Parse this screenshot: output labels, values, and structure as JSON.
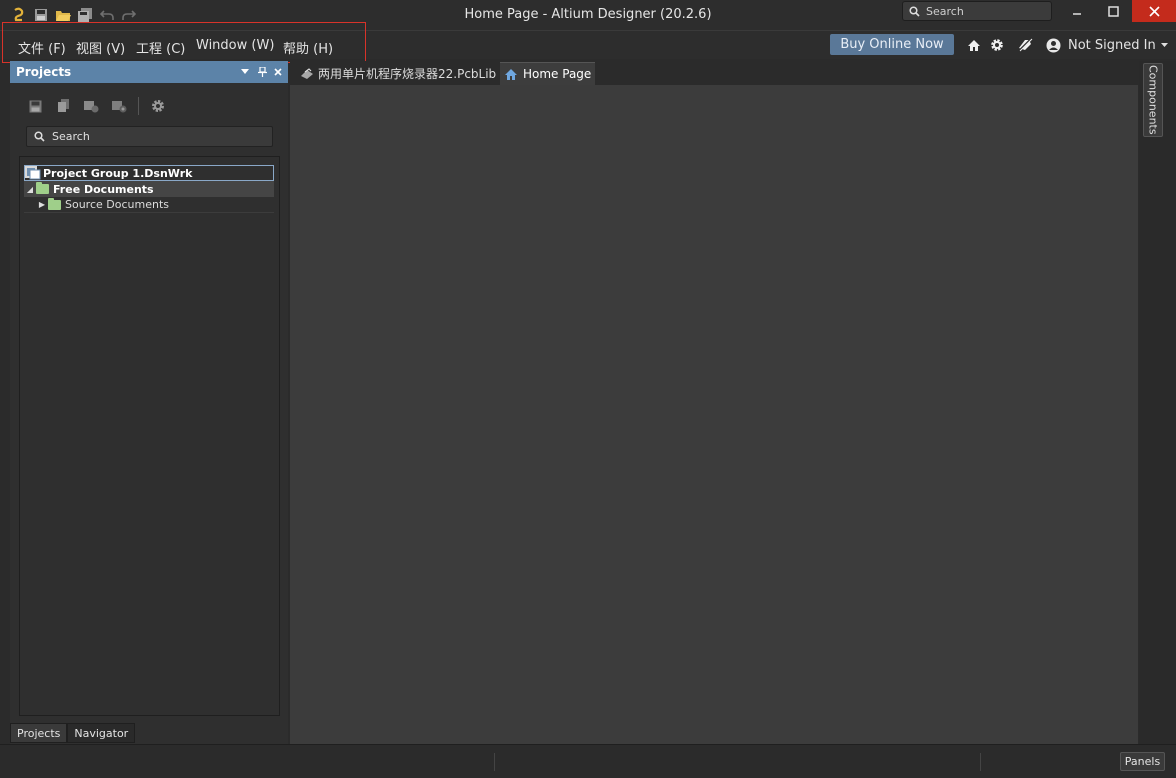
{
  "window": {
    "title": "Home Page - Altium Designer (20.2.6)",
    "search_placeholder": "Search",
    "minimize_icon": "minimize-icon",
    "maximize_icon": "maximize-icon",
    "close_icon": "close-icon",
    "close_color": "#c42b1c"
  },
  "quick_access": [
    "app-logo-icon",
    "save-icon",
    "open-folder-icon",
    "save-all-icon",
    "undo-icon",
    "redo-icon"
  ],
  "menu": {
    "items": [
      {
        "label": "文件 (F)"
      },
      {
        "label": "视图 (V)"
      },
      {
        "label": "工程 (C)"
      },
      {
        "label": "Window (W)"
      },
      {
        "label": "帮助 (H)"
      }
    ],
    "highlight_color": "#d8332a"
  },
  "toolbar": {
    "buy_label": "Buy Online Now",
    "buy_color": "#5a7898",
    "user_label": "Not Signed In"
  },
  "projects_panel": {
    "title": "Projects",
    "header_color": "#5c83a8",
    "search_placeholder": "Search",
    "tree": {
      "group": "Project Group 1.DsnWrk",
      "free_documents": "Free Documents",
      "source_documents": "Source Documents"
    },
    "bottom_tabs": [
      "Projects",
      "Navigator"
    ]
  },
  "document_tabs": [
    {
      "label": "两用单片机程序烧录器22.PcbLib",
      "active": false
    },
    {
      "label": "Home Page",
      "active": true
    }
  ],
  "right_panel": {
    "components_label": "Components"
  },
  "statusbar": {
    "panels_label": "Panels"
  }
}
